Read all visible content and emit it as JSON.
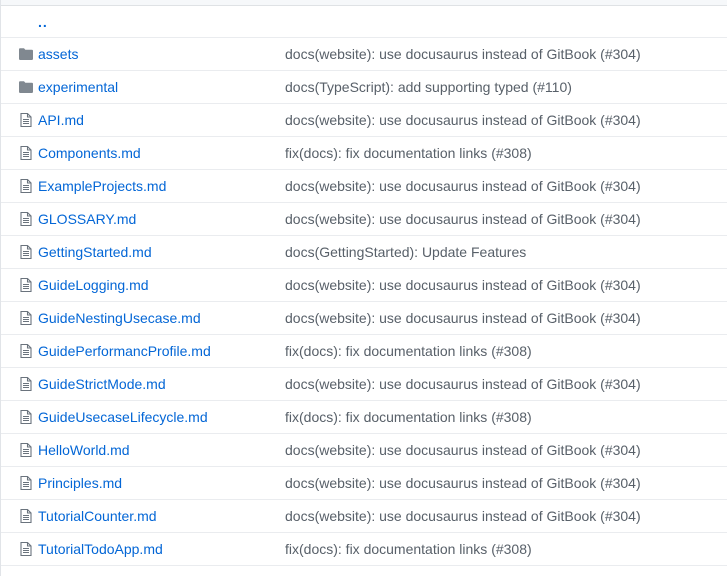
{
  "parent": {
    "label": ".."
  },
  "colors": {
    "link": "#0366d6",
    "folder_icon": "#79b8ff",
    "file_icon": "#6a737d",
    "message": "#586069"
  },
  "rows": [
    {
      "type": "folder",
      "icon": "folder-icon",
      "name": "assets",
      "message": "docs(website): use docusaurus instead of GitBook (#304)"
    },
    {
      "type": "folder",
      "icon": "folder-icon",
      "name": "experimental",
      "message": "docs(TypeScript): add supporting typed (#110)"
    },
    {
      "type": "file",
      "icon": "file-text-icon",
      "name": "API.md",
      "message": "docs(website): use docusaurus instead of GitBook (#304)"
    },
    {
      "type": "file",
      "icon": "file-text-icon",
      "name": "Components.md",
      "message": "fix(docs): fix documentation links (#308)"
    },
    {
      "type": "file",
      "icon": "file-text-icon",
      "name": "ExampleProjects.md",
      "message": "docs(website): use docusaurus instead of GitBook (#304)"
    },
    {
      "type": "file",
      "icon": "file-text-icon",
      "name": "GLOSSARY.md",
      "message": "docs(website): use docusaurus instead of GitBook (#304)"
    },
    {
      "type": "file",
      "icon": "file-text-icon",
      "name": "GettingStarted.md",
      "message": "docs(GettingStarted): Update Features"
    },
    {
      "type": "file",
      "icon": "file-text-icon",
      "name": "GuideLogging.md",
      "message": "docs(website): use docusaurus instead of GitBook (#304)"
    },
    {
      "type": "file",
      "icon": "file-text-icon",
      "name": "GuideNestingUsecase.md",
      "message": "docs(website): use docusaurus instead of GitBook (#304)"
    },
    {
      "type": "file",
      "icon": "file-text-icon",
      "name": "GuidePerformancProfile.md",
      "message": "fix(docs): fix documentation links (#308)"
    },
    {
      "type": "file",
      "icon": "file-text-icon",
      "name": "GuideStrictMode.md",
      "message": "docs(website): use docusaurus instead of GitBook (#304)"
    },
    {
      "type": "file",
      "icon": "file-text-icon",
      "name": "GuideUsecaseLifecycle.md",
      "message": "fix(docs): fix documentation links (#308)"
    },
    {
      "type": "file",
      "icon": "file-text-icon",
      "name": "HelloWorld.md",
      "message": "docs(website): use docusaurus instead of GitBook (#304)"
    },
    {
      "type": "file",
      "icon": "file-text-icon",
      "name": "Principles.md",
      "message": "docs(website): use docusaurus instead of GitBook (#304)"
    },
    {
      "type": "file",
      "icon": "file-text-icon",
      "name": "TutorialCounter.md",
      "message": "docs(website): use docusaurus instead of GitBook (#304)"
    },
    {
      "type": "file",
      "icon": "file-text-icon",
      "name": "TutorialTodoApp.md",
      "message": "fix(docs): fix documentation links (#308)"
    }
  ]
}
